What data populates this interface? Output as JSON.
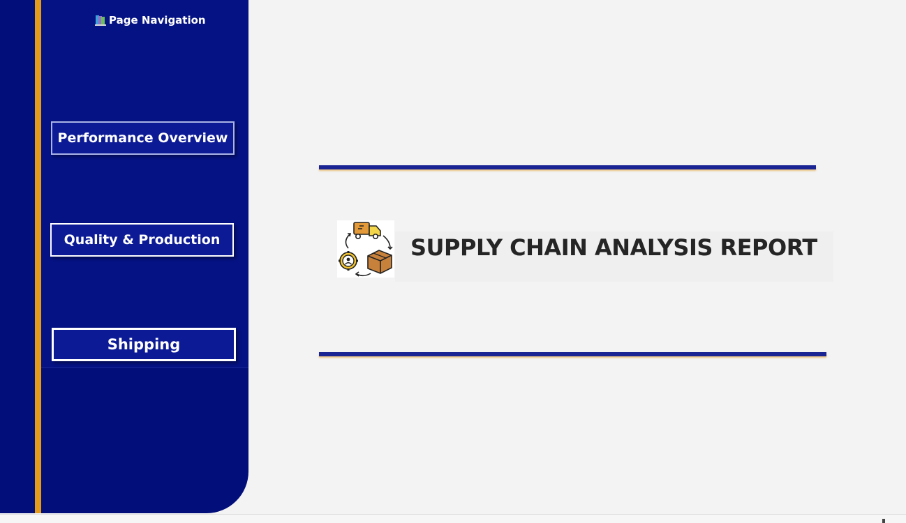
{
  "navigation": {
    "title": "Page Navigation",
    "title_icon": "books-icon",
    "buttons": [
      {
        "label": "Performance Overview"
      },
      {
        "label": "Quality & Production"
      },
      {
        "label": "Shipping"
      }
    ]
  },
  "report": {
    "title": "SUPPLY CHAIN ANALYSIS REPORT",
    "logo_icon": "supply-chain-cycle-icon"
  },
  "colors": {
    "sidebar": "#020e7a",
    "accent_stripe": "#e49a1b",
    "button_fill": "#0c1a95",
    "rule": "#1a2593",
    "background": "#f3f3f3",
    "title_text": "#252525"
  }
}
